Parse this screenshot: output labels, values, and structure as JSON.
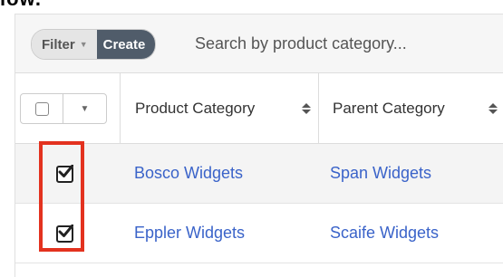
{
  "overhead_text": "low.",
  "toolbar": {
    "filter_label": "Filter",
    "create_label": "Create",
    "search_placeholder": "Search by product category..."
  },
  "table": {
    "columns": [
      {
        "label": "Product Category",
        "sortable": true
      },
      {
        "label": "Parent Category",
        "sortable": true
      }
    ],
    "rows": [
      {
        "checked": true,
        "product_category": "Bosco Widgets",
        "parent_category": "Span Widgets"
      },
      {
        "checked": true,
        "product_category": "Eppler Widgets",
        "parent_category": "Scaife Widgets"
      }
    ]
  },
  "colors": {
    "link": "#3a63c9",
    "create_button": "#505c6a",
    "highlight": "#e3321f",
    "selected_row": "#f4f4f4"
  }
}
